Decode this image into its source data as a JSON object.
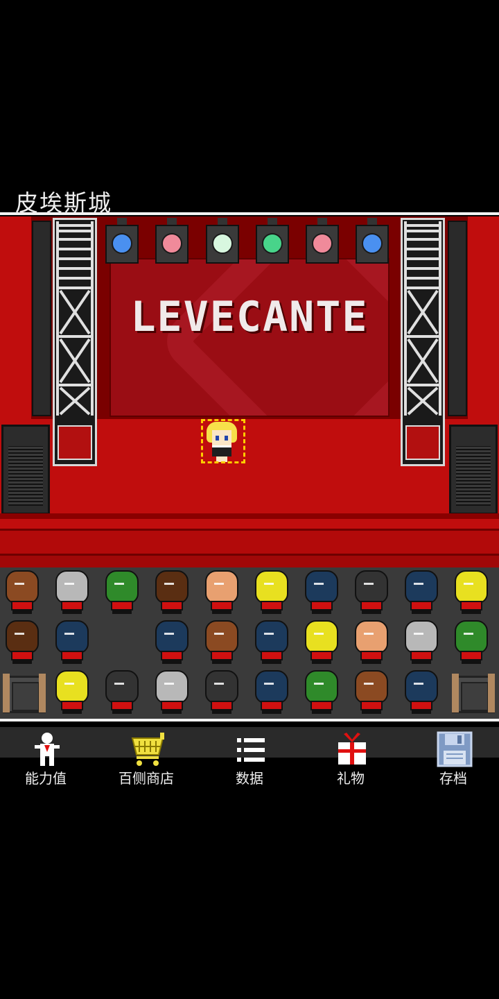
{
  "location": {
    "name": "皮埃斯城"
  },
  "stage": {
    "brand": "LEVECANTE"
  },
  "lights": [
    {
      "color": "#4a90f0"
    },
    {
      "color": "#f08a9a"
    },
    {
      "color": "#d8f7df"
    },
    {
      "color": "#48d48a"
    },
    {
      "color": "#f08a9a"
    },
    {
      "color": "#4a90f0"
    }
  ],
  "audience": {
    "rows": [
      [
        "#8b4a22",
        "#b8b8b8",
        "#2f8a2a",
        "#5a2e12",
        "#e8a070",
        "#e8e020",
        "#1c3a5c",
        "#333333",
        "#1c3a5c",
        "#e8e020"
      ],
      [
        "#5a2e12",
        "#1c3a5c",
        "",
        "#1c3a5c",
        "#8b4a22",
        "#1c3a5c",
        "#e8e020",
        "#e8a070",
        "#b8b8b8",
        "#2f8a2a"
      ],
      [
        "seat",
        "#e8e020",
        "#333333",
        "#b8b8b8",
        "#333333",
        "#1c3a5c",
        "#2f8a2a",
        "#8b4a22",
        "#1c3a5c",
        "seat"
      ]
    ]
  },
  "nav": {
    "items": [
      {
        "label": "能力值",
        "icon": "character-stats-icon"
      },
      {
        "label": "百侧商店",
        "icon": "shopping-cart-icon"
      },
      {
        "label": "数据",
        "icon": "list-icon"
      },
      {
        "label": "礼物",
        "icon": "gift-icon"
      },
      {
        "label": "存档",
        "icon": "save-disk-icon"
      }
    ]
  }
}
